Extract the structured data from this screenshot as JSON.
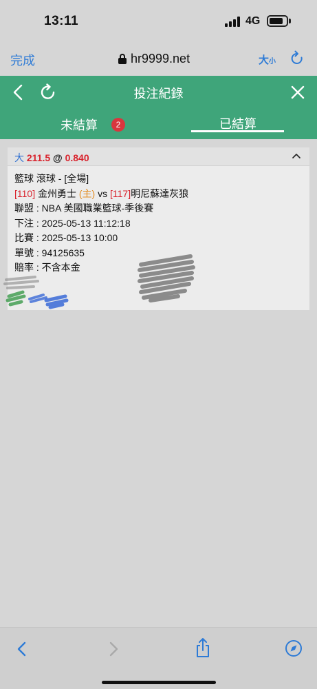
{
  "status_bar": {
    "time": "13:11",
    "network": "4G",
    "icons": [
      "cellular-signal-icon",
      "battery-icon"
    ]
  },
  "browser": {
    "done_label": "完成",
    "url": "hr9999.net",
    "text_size_big": "大",
    "text_size_small": "小",
    "icons": [
      "lock-icon",
      "reload-icon"
    ]
  },
  "header": {
    "title": "投注紀錄",
    "icons": [
      "back-icon",
      "refresh-icon",
      "close-icon"
    ]
  },
  "tabs": [
    {
      "label": "未結算",
      "badge": "2",
      "active": false
    },
    {
      "label": "已結算",
      "active": true
    }
  ],
  "record": {
    "pick": "大",
    "line": "211.5",
    "at": "@",
    "odds": "0.840",
    "sport": "籃球 滾球 - [全場]",
    "home_code": "[110]",
    "home_team": "金州勇士",
    "home_marker": "(主)",
    "vs": "vs",
    "away_code": "[117]",
    "away_team": "明尼蘇達灰狼",
    "league_label": "聯盟 : ",
    "league": "NBA 美國職業籃球-季後賽",
    "bet_time_label": "下注 : ",
    "bet_time": "2025-05-13 11:12:18",
    "match_time_label": "比賽 : ",
    "match_time": "2025-05-13 10:00",
    "ticket_label": "單號 : ",
    "ticket": "94125635",
    "odds_type_label": "賠率 : ",
    "odds_type": "不含本金"
  },
  "colors": {
    "green": "#3fa57a",
    "badge_red": "#d9363e",
    "link_blue": "#2e7bd6",
    "value_red": "#d9232d",
    "home_orange": "#e38b1f"
  },
  "toolbar": {
    "icons": [
      "nav-back-icon",
      "nav-forward-icon",
      "share-icon",
      "compass-icon"
    ]
  }
}
